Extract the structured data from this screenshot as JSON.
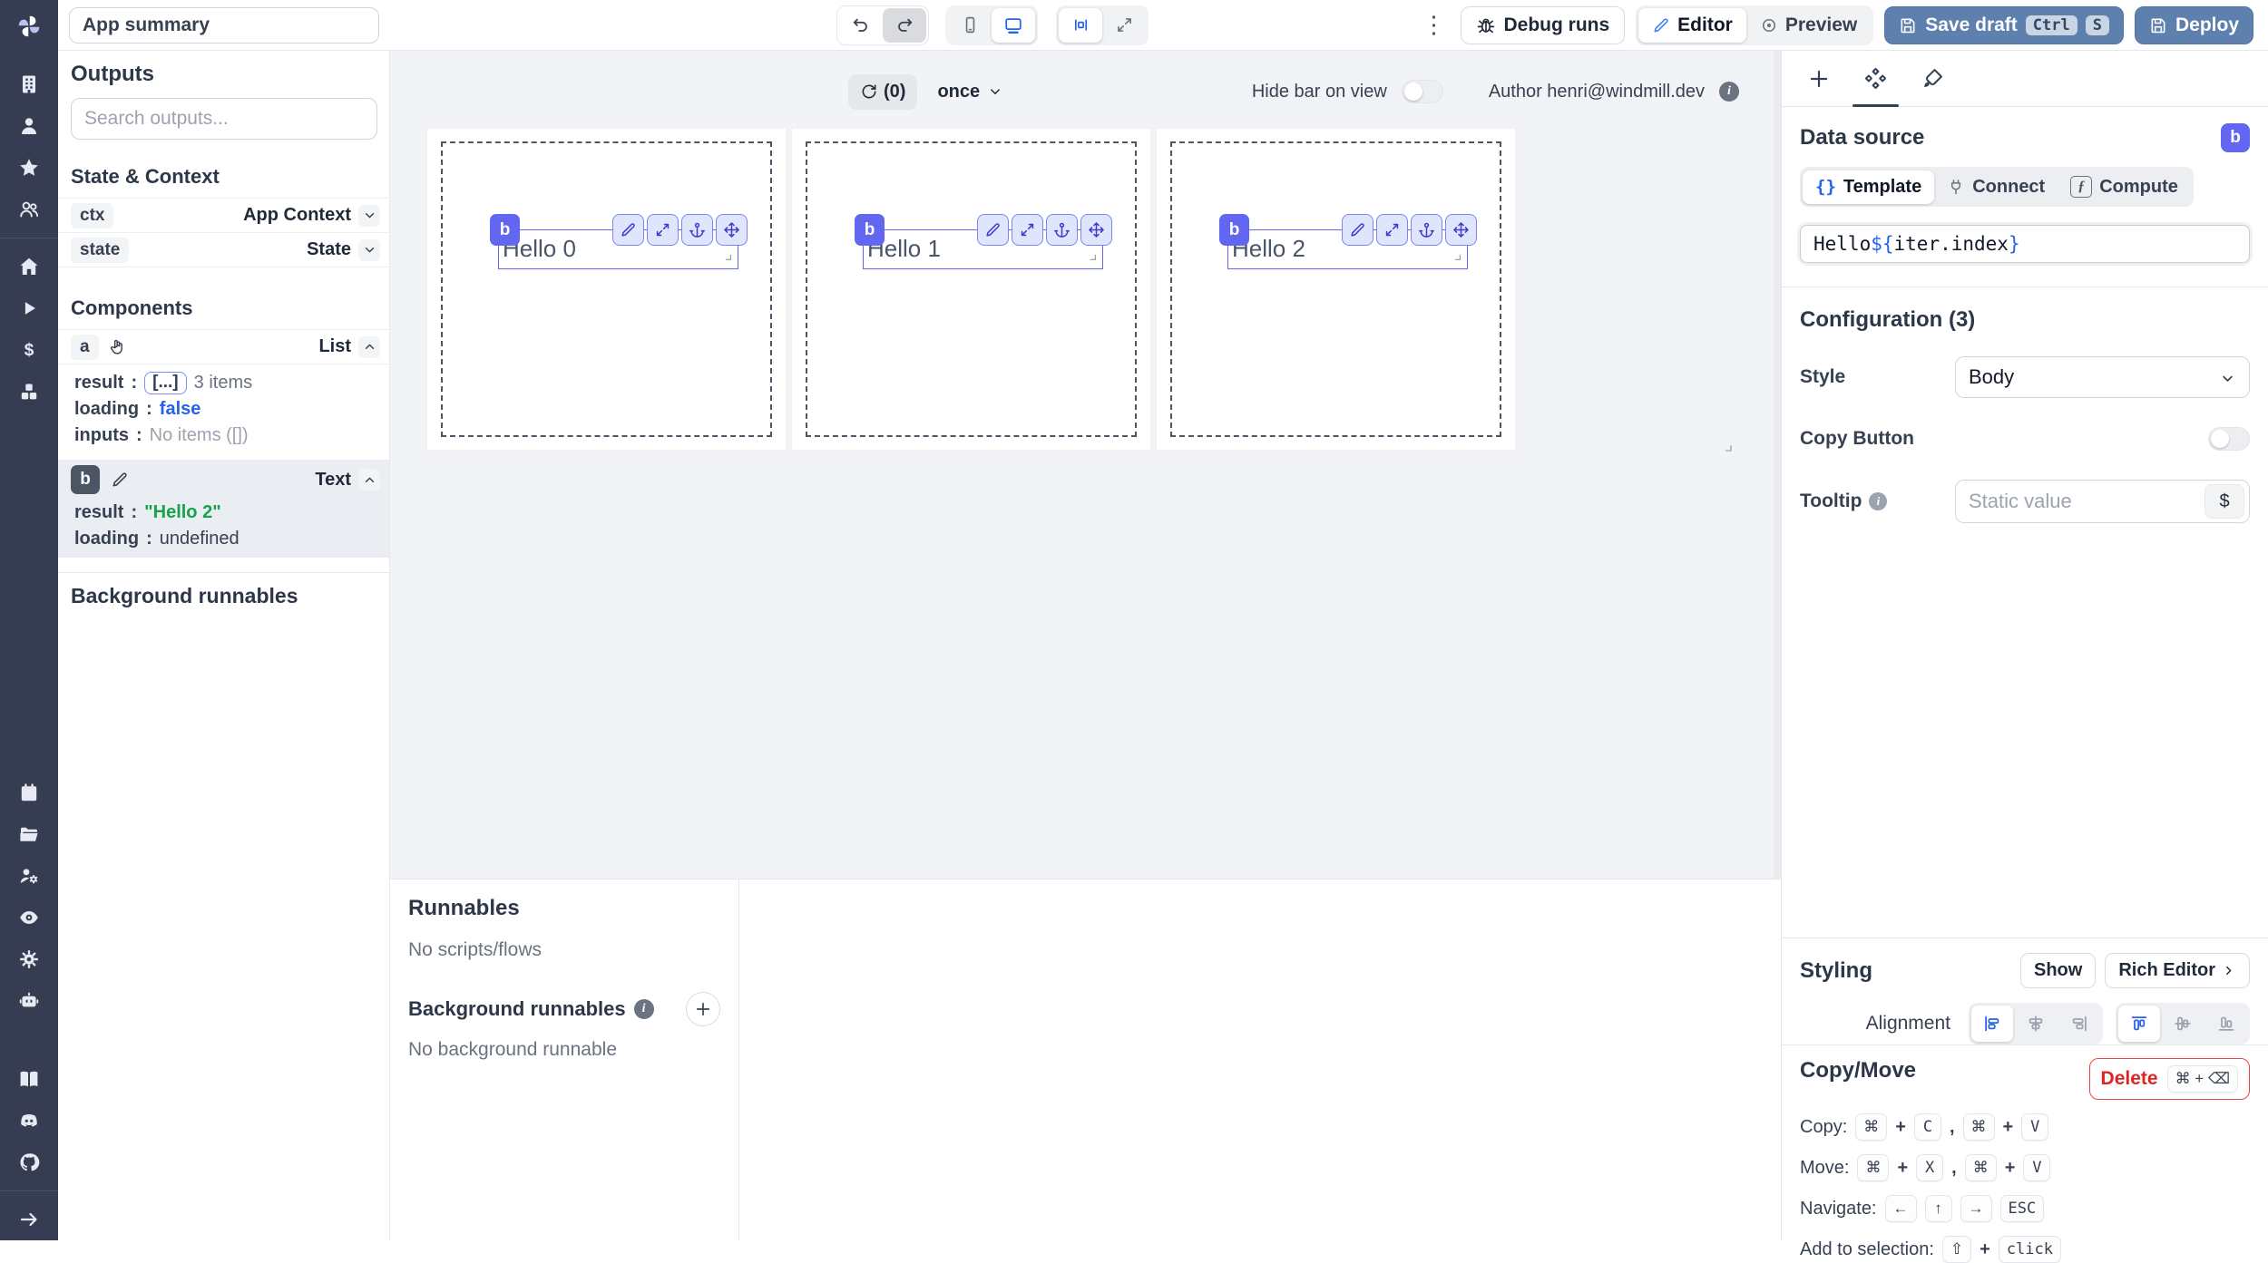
{
  "colors": {
    "accent_indigo": "#6366f1",
    "accent_blue": "#2563eb",
    "steel_blue": "#5e80ae",
    "danger": "#dc2626",
    "success": "#16a34a",
    "rail_bg": "#363c51"
  },
  "rail": {
    "icons": [
      "windmill-logo",
      "building",
      "user",
      "star",
      "users",
      "home",
      "play",
      "dollar",
      "cubes",
      "calendar",
      "folder",
      "user-cog",
      "eye",
      "settings",
      "bot",
      "book",
      "discord",
      "github",
      "arrow-right"
    ]
  },
  "topbar": {
    "debug_runs": "Debug runs",
    "editor": "Editor",
    "preview": "Preview",
    "save_draft": "Save draft",
    "key_ctrl": "Ctrl",
    "key_s": "S",
    "deploy": "Deploy"
  },
  "left_panel": {
    "app_summary_value": "App summary",
    "outputs_title": "Outputs",
    "search_placeholder": "Search outputs...",
    "state_context_title": "State & Context",
    "ctx_key": "ctx",
    "ctx_value": "App Context",
    "state_key": "state",
    "state_value": "State",
    "components_title": "Components",
    "comp_a_id": "a",
    "comp_a_type": "List",
    "label_result": "result",
    "label_loading": "loading",
    "label_inputs": "inputs",
    "colon": ":",
    "a_result_chip": "[...]",
    "a_result_info": "3 items",
    "a_loading": "false",
    "a_inputs": "No items ([])",
    "comp_b_id": "b",
    "comp_b_type": "Text",
    "b_result": "\"Hello 2\"",
    "b_loading": "undefined",
    "background_runnables_title": "Background runnables"
  },
  "canvas": {
    "refresh_count": "(0)",
    "schedule": "once",
    "hide_bar_label": "Hide bar on view",
    "author_label": "Author henri@windmill.dev",
    "cards": [
      {
        "badge": "b",
        "text": "Hello 0"
      },
      {
        "badge": "b",
        "text": "Hello 1"
      },
      {
        "badge": "b",
        "text": "Hello 2"
      }
    ]
  },
  "runnables": {
    "title": "Runnables",
    "empty": "No scripts/flows",
    "bg_title": "Background runnables",
    "bg_empty": "No background runnable"
  },
  "right_panel": {
    "data_source_title": "Data source",
    "badge": "b",
    "tab_template": "Template",
    "tab_connect": "Connect",
    "tab_compute": "Compute",
    "braces_icon": "{}",
    "code_prefix": "Hello ",
    "code_open": "${",
    "code_expr": "iter.index",
    "code_close": "}",
    "configuration_title": "Configuration (3)",
    "style_label": "Style",
    "style_value": "Body",
    "copy_button_label": "Copy Button",
    "tooltip_label": "Tooltip",
    "tooltip_placeholder": "Static value",
    "tooltip_suffix": "$",
    "styling_title": "Styling",
    "show_btn": "Show",
    "rich_editor_btn": "Rich Editor",
    "alignment_label": "Alignment",
    "copymove_title": "Copy/Move",
    "delete_btn": "Delete",
    "delete_kbd": "⌘ + ⌫",
    "copy_label": "Copy:",
    "move_label": "Move:",
    "navigate_label": "Navigate:",
    "add_label": "Add to selection:",
    "k_cmd": "⌘",
    "k_plus": "+",
    "k_comma": ",",
    "k_c": "C",
    "k_v": "V",
    "k_x": "X",
    "k_left": "←",
    "k_up": "↑",
    "k_right": "→",
    "k_esc": "ESC",
    "k_shift": "⇧",
    "k_click": "click"
  }
}
